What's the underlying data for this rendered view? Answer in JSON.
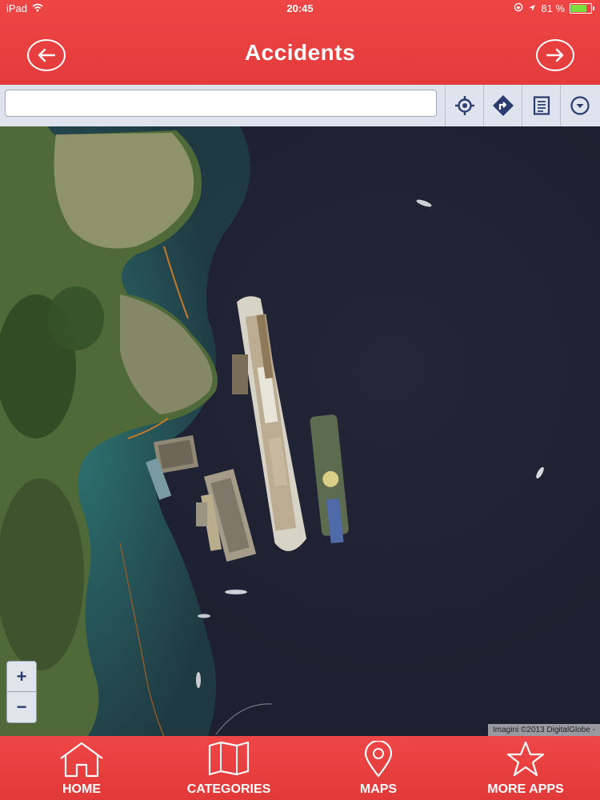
{
  "status_bar": {
    "device": "iPad",
    "time": "20:45",
    "battery": "81 %",
    "battery_level": 0.81
  },
  "nav": {
    "title": "Accidents",
    "back_icon": "arrow-left-circle-icon",
    "forward_icon": "arrow-right-circle-icon"
  },
  "search": {
    "value": "",
    "placeholder": ""
  },
  "toolbar": {
    "icons": [
      "locate-icon",
      "directions-icon",
      "list-icon",
      "dropdown-circle-icon"
    ]
  },
  "map": {
    "zoom_in": "+",
    "zoom_out": "−",
    "attribution": "Imagini ©2013 DigitalGlobe -"
  },
  "tabs": [
    {
      "label": "HOME",
      "icon": "home-icon"
    },
    {
      "label": "CATEGORIES",
      "icon": "map-book-icon"
    },
    {
      "label": "MAPS",
      "icon": "location-pin-icon"
    },
    {
      "label": "MORE APPS",
      "icon": "star-icon"
    }
  ],
  "colors": {
    "brand_red": "#e83e3e",
    "toolbar_bg": "#dfe3ee",
    "icon_blue": "#2a3d6e"
  }
}
